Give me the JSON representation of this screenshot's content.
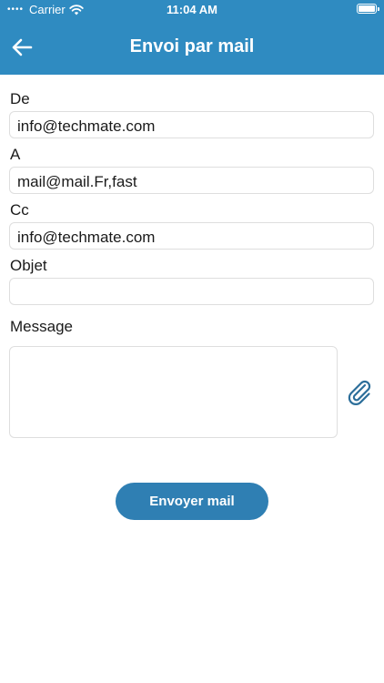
{
  "status_bar": {
    "carrier": "Carrier",
    "time": "11:04 AM"
  },
  "header": {
    "title": "Envoi par mail"
  },
  "form": {
    "from": {
      "label": "De",
      "value": "info@techmate.com"
    },
    "to": {
      "label": "A",
      "value": "mail@mail.Fr,fast"
    },
    "cc": {
      "label": "Cc",
      "value": "info@techmate.com"
    },
    "subject": {
      "label": "Objet",
      "value": ""
    },
    "message": {
      "label": "Message",
      "value": ""
    }
  },
  "actions": {
    "send_label": "Envoyer mail"
  },
  "icons": {
    "back": "arrow-left-icon",
    "attach": "paperclip-icon",
    "wifi": "wifi-icon",
    "battery": "battery-icon"
  },
  "colors": {
    "header": "#2f8bc1",
    "button": "#2f7fb3",
    "attach_icon": "#2c6e9a"
  }
}
